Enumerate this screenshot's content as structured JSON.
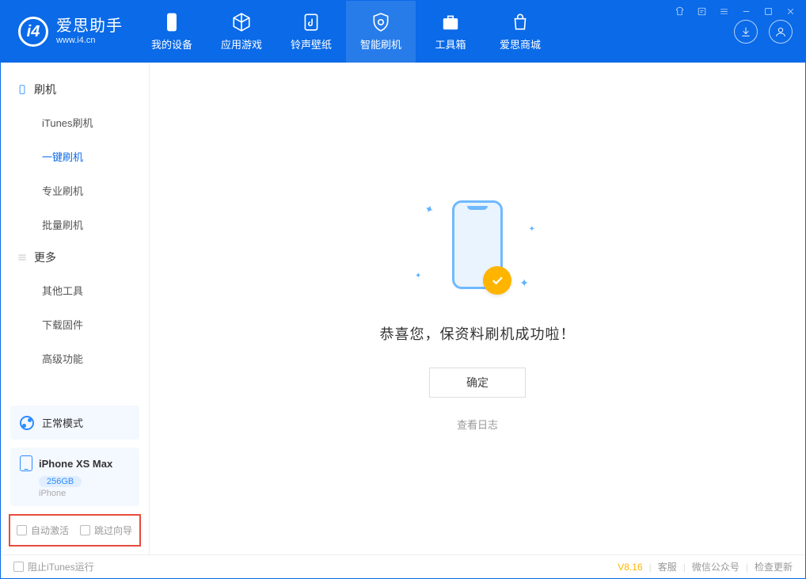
{
  "app": {
    "title": "爱思助手",
    "subtitle": "www.i4.cn"
  },
  "nav": {
    "device": "我的设备",
    "apps": "应用游戏",
    "ringtones": "铃声壁纸",
    "flash": "智能刷机",
    "tools": "工具箱",
    "store": "爱思商城"
  },
  "sidebar": {
    "section_flash": "刷机",
    "items": {
      "itunes": "iTunes刷机",
      "onekey": "一键刷机",
      "pro": "专业刷机",
      "batch": "批量刷机"
    },
    "section_more": "更多",
    "more": {
      "other": "其他工具",
      "firmware": "下载固件",
      "advanced": "高级功能"
    },
    "mode": "正常模式",
    "device_name": "iPhone XS Max",
    "device_storage": "256GB",
    "device_type": "iPhone",
    "opt_auto_activate": "自动激活",
    "opt_skip_guide": "跳过向导"
  },
  "main": {
    "message": "恭喜您，保资料刷机成功啦！",
    "confirm": "确定",
    "view_log": "查看日志"
  },
  "footer": {
    "block_itunes": "阻止iTunes运行",
    "version": "V8.16",
    "support": "客服",
    "wechat": "微信公众号",
    "update": "检查更新"
  }
}
